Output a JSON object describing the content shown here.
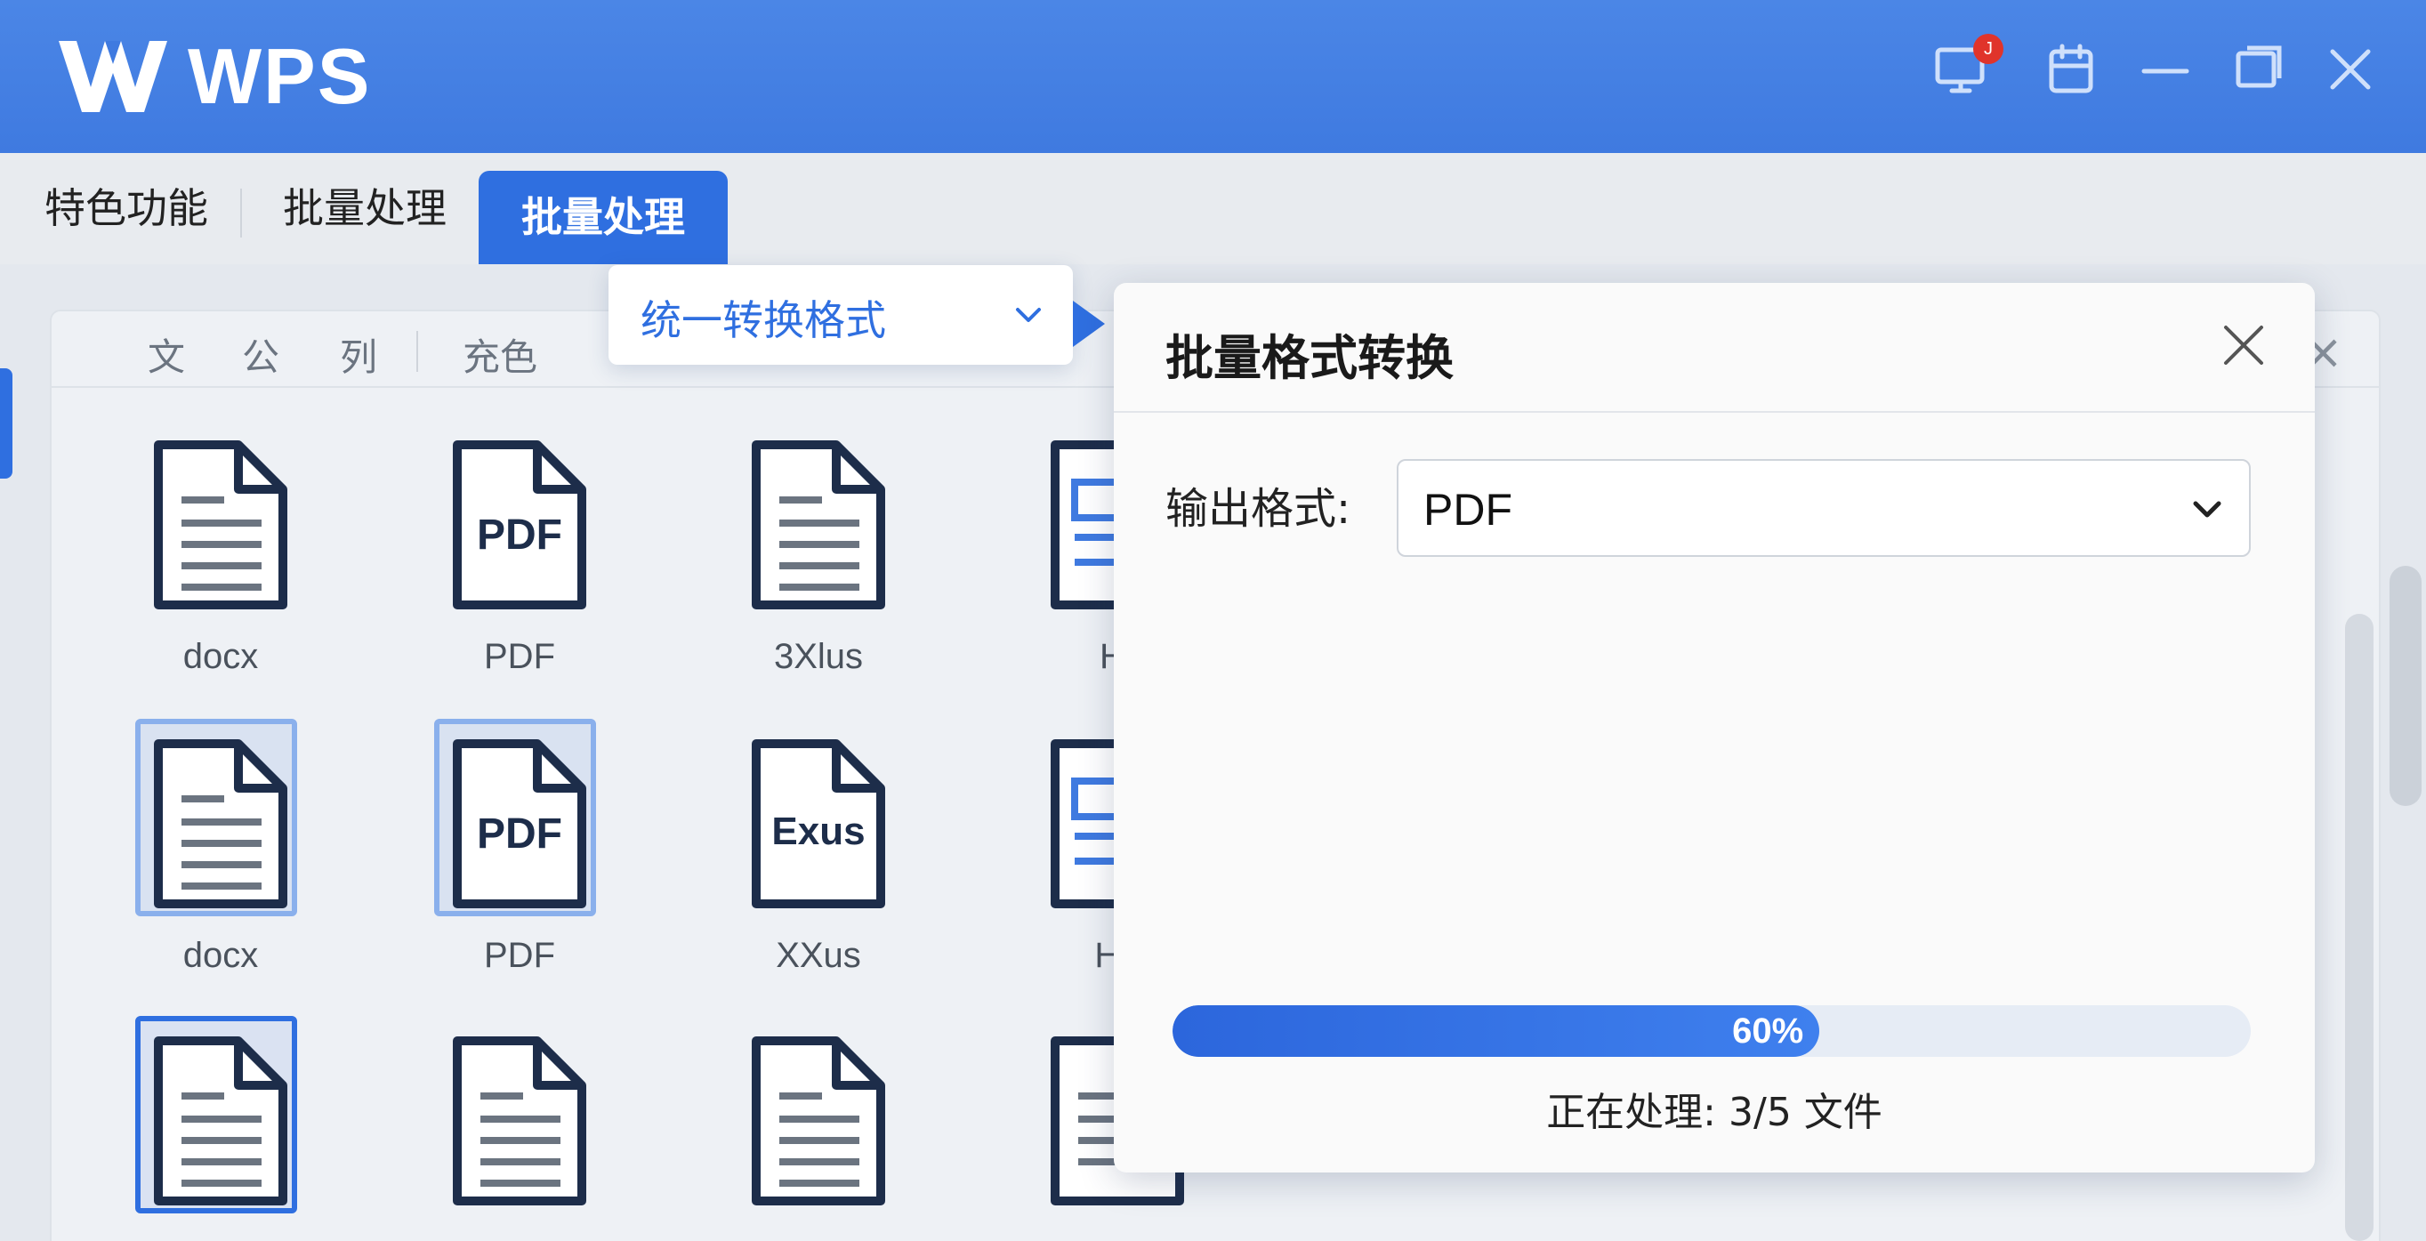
{
  "app": {
    "logo_text": "WPS",
    "notification_count": "J"
  },
  "tabs": [
    {
      "label": "特色功能"
    },
    {
      "label": "批量处理"
    },
    {
      "label": "批量处理",
      "active": true
    }
  ],
  "panel_toolbar": {
    "items": [
      "文",
      "公",
      "列",
      "充色"
    ]
  },
  "files": {
    "row1": [
      "docx",
      "PDF",
      "3Xlus",
      "Ht"
    ],
    "row2": [
      "docx",
      "PDF",
      "XXus",
      "Ho"
    ],
    "icon_text": {
      "pdf": "PDF",
      "exus": "Exus"
    }
  },
  "menu": {
    "label": "统一转换格式"
  },
  "dialog": {
    "title": "批量格式转换",
    "output_format_label": "输出格式:",
    "output_format_value": "PDF",
    "progress_percent": 60,
    "progress_label": "60%",
    "status": "正在处理: 3/5 文件"
  },
  "icons": [
    "monitor-icon",
    "clipboard-icon",
    "minimize-icon",
    "restore-icon",
    "close-icon",
    "chevron-down-icon",
    "document-icon"
  ],
  "colors": {
    "brand_blue": "#3f7ae0",
    "accent_blue": "#2f6fe0",
    "badge_red": "#e0342b"
  }
}
